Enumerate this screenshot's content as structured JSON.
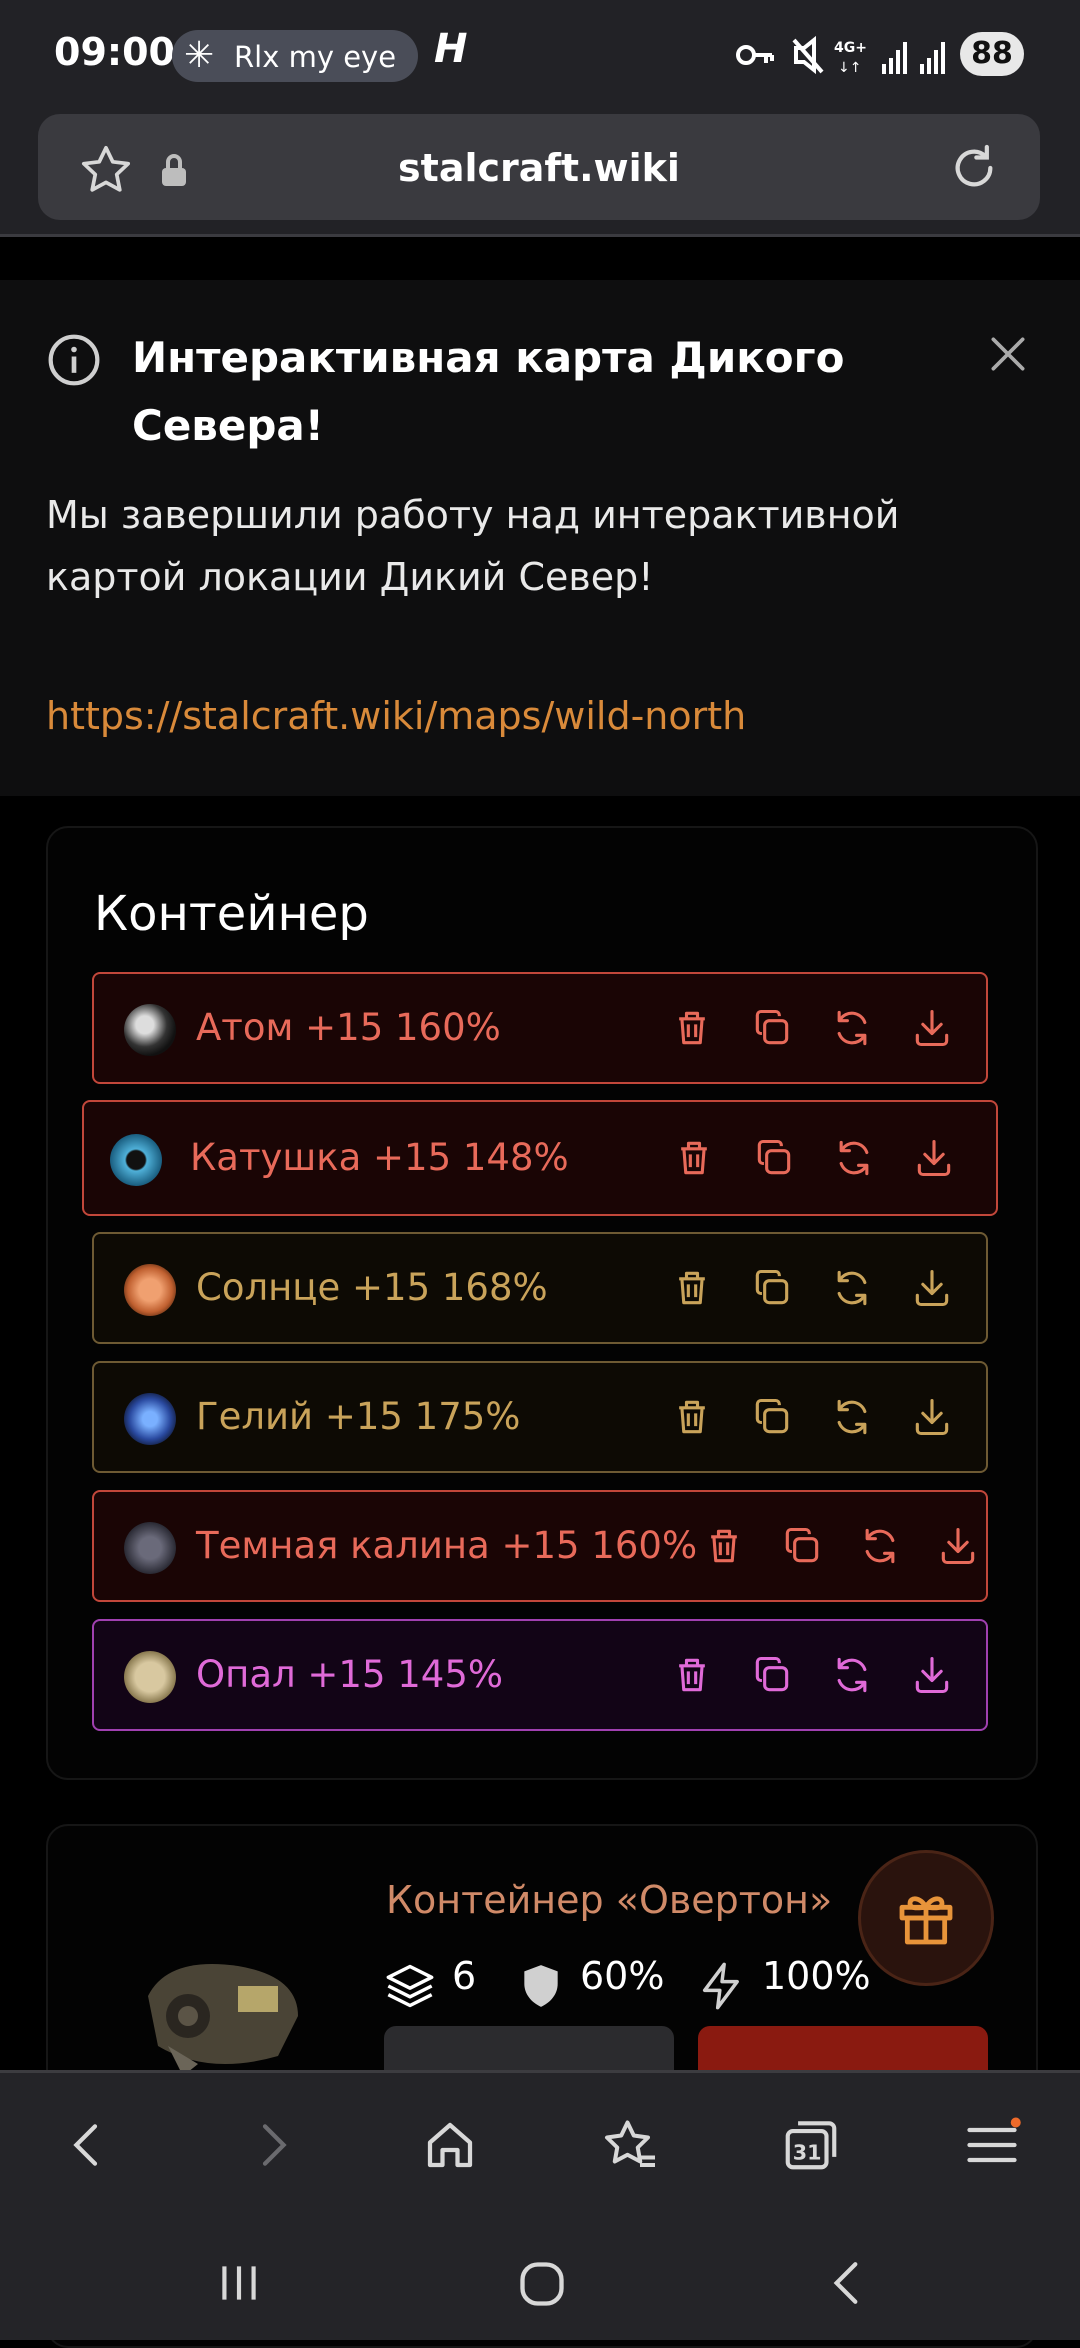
{
  "status_bar": {
    "time": "09:00",
    "notification_text": "Rlx my eye",
    "battery": "88"
  },
  "browser": {
    "url": "stalcraft.wiki"
  },
  "notice": {
    "title": "Интерактивная карта Дикого Севера!",
    "body": "Мы завершили работу над интерактивной картой локации Дикий Север!",
    "link": "https://stalcraft.wiki/maps/wild-north"
  },
  "container": {
    "title": "Контейнер",
    "items": [
      {
        "label": "Атом +15 160%",
        "color": "#e86a5a",
        "border": "#c2473a",
        "bg": "#1a0505"
      },
      {
        "label": "Катушка +15 148%",
        "color": "#e86a5a",
        "border": "#c2473a",
        "bg": "#1a0505"
      },
      {
        "label": "Солнце +15 168%",
        "color": "#c9a35a",
        "border": "#6e5a33",
        "bg": "#0d0a04"
      },
      {
        "label": "Гелий +15 175%",
        "color": "#c9a35a",
        "border": "#6e5a33",
        "bg": "#0d0a04"
      },
      {
        "label": "Темная калина +15 160%",
        "color": "#e86a5a",
        "border": "#c2473a",
        "bg": "#1a0505"
      },
      {
        "label": "Опал +15 145%",
        "color": "#e06ad8",
        "border": "#a040b0",
        "bg": "#120416"
      }
    ]
  },
  "overton": {
    "title": "Контейнер «Овертон»",
    "slots": "6",
    "protection": "60%",
    "efficiency": "100%"
  }
}
